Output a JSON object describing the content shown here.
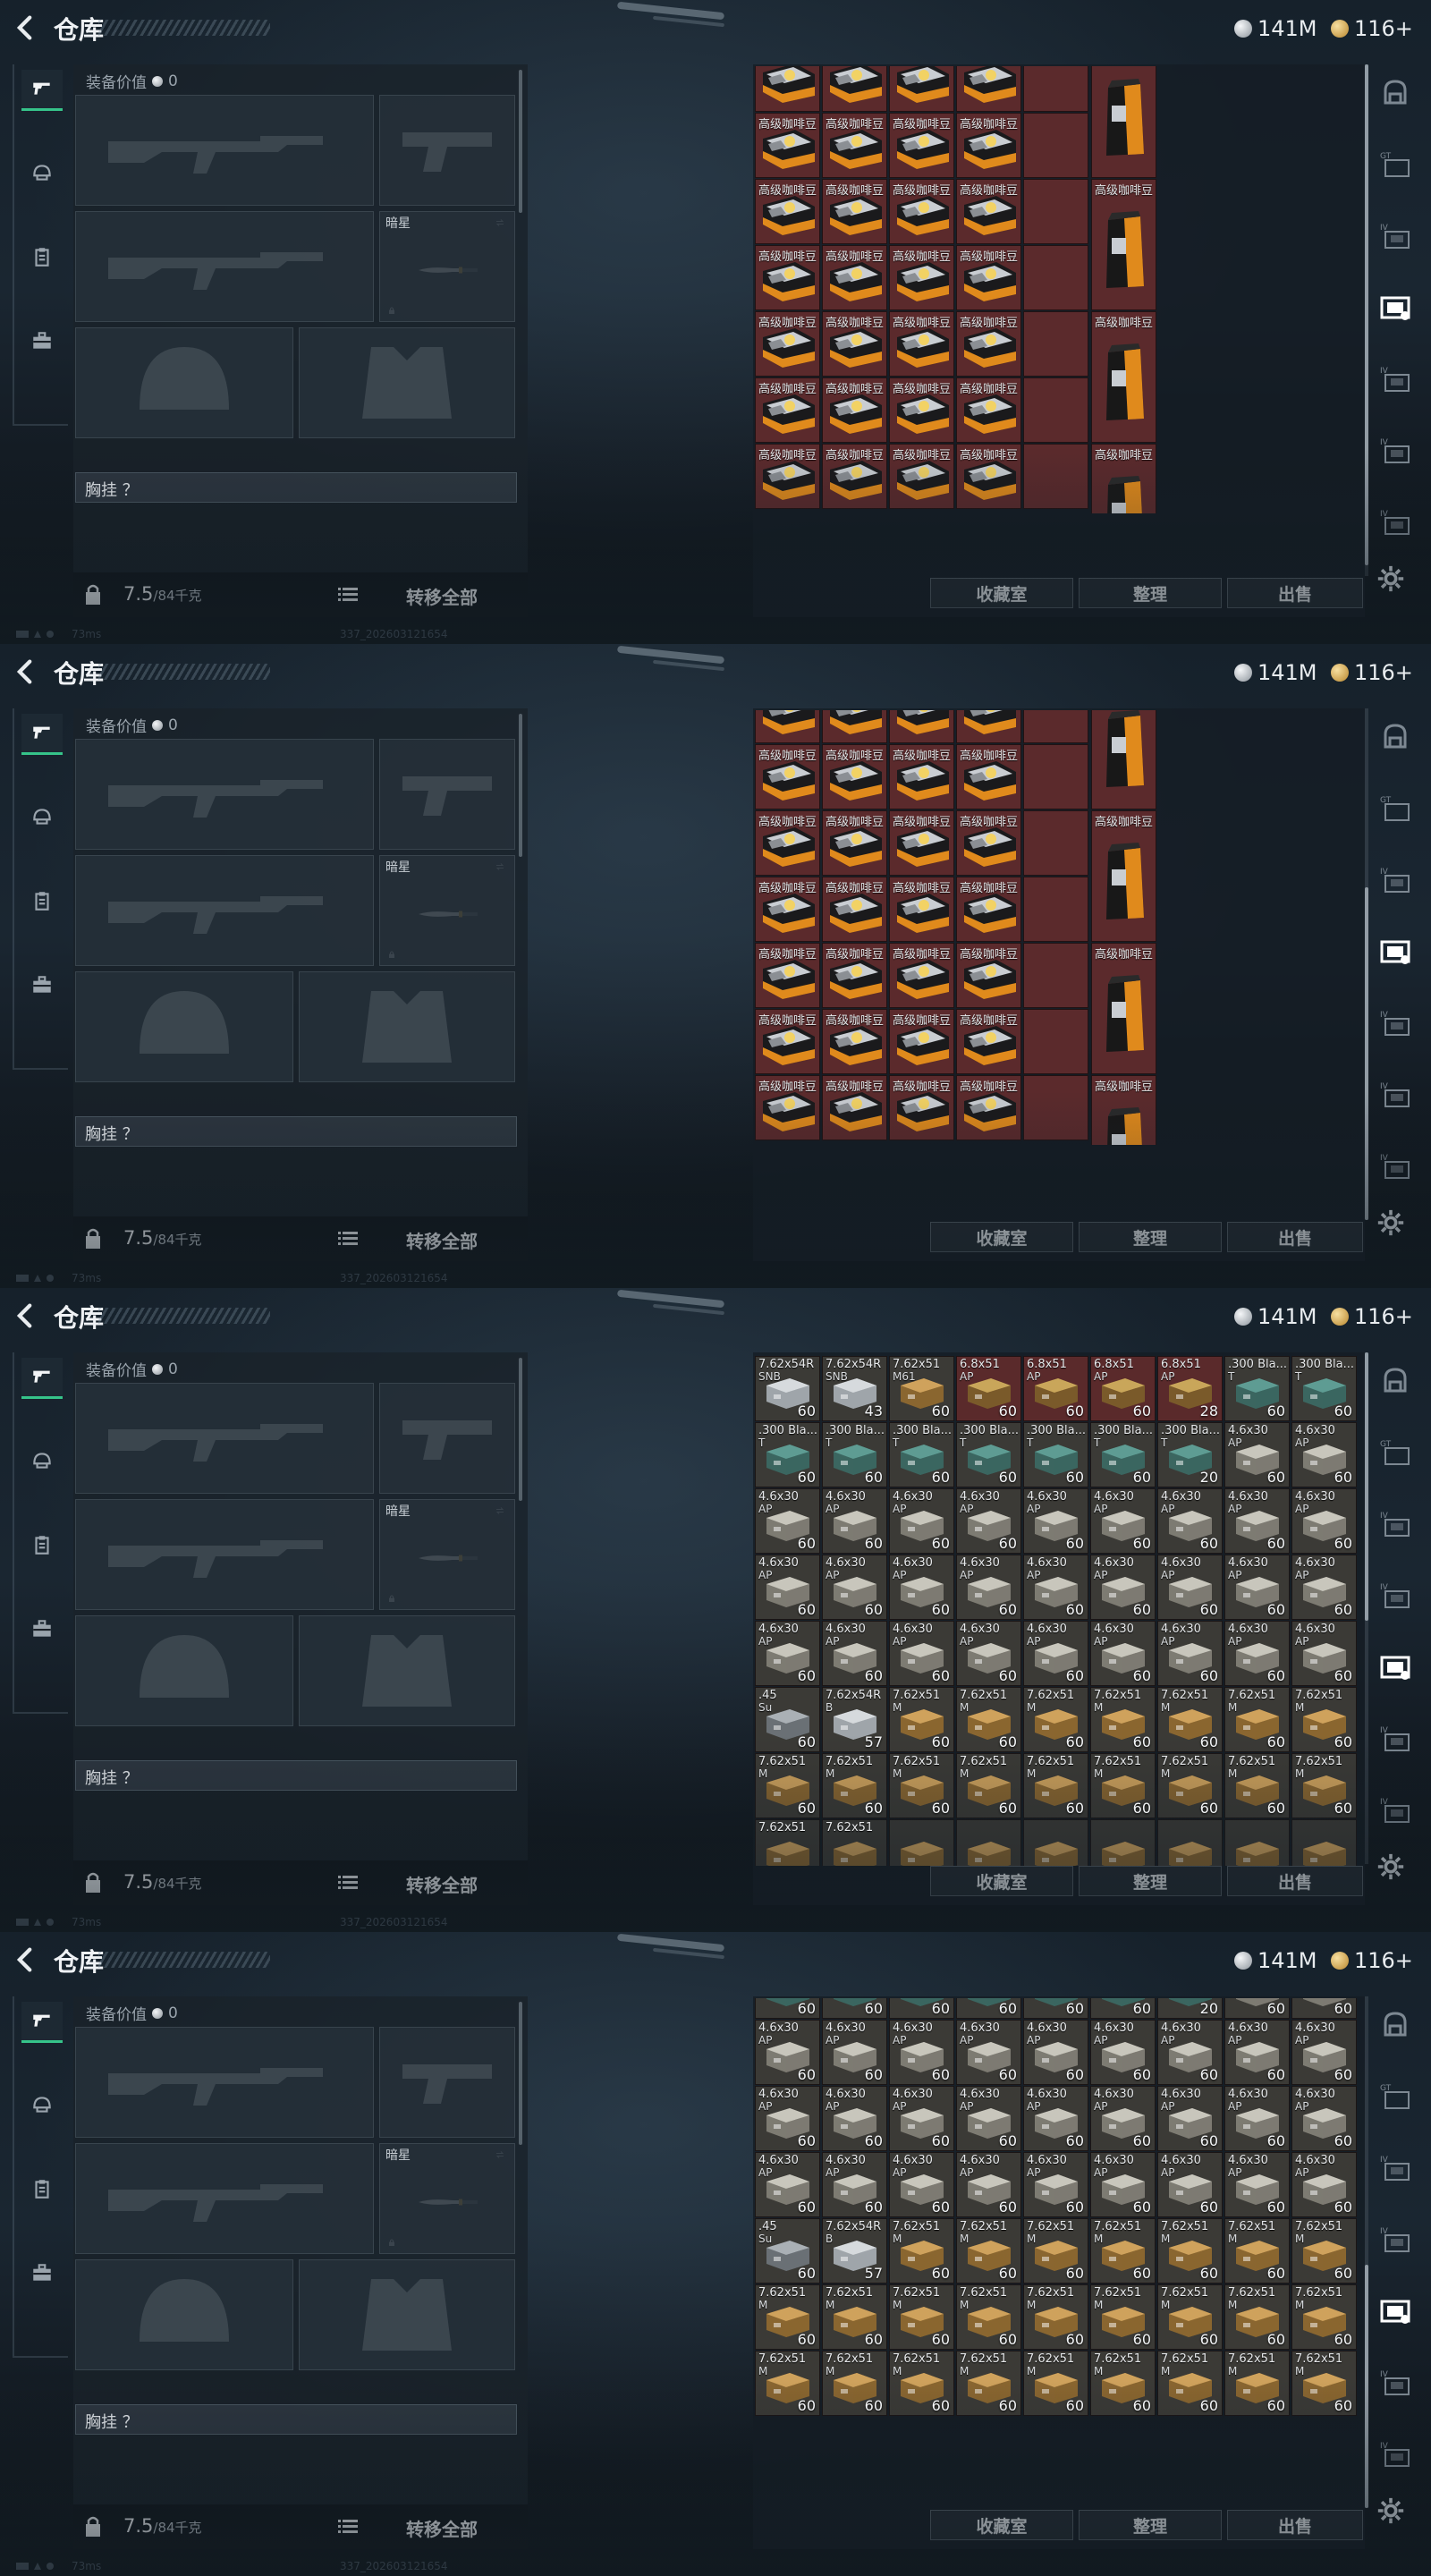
{
  "topbar": {
    "title": "仓库",
    "silver_amount": "141M",
    "gold_amount": "116+",
    "back_icon": "chevron-left-icon"
  },
  "equipment": {
    "value_label": "装备价值",
    "value_amount": "0",
    "knife_label": "暗星",
    "vest_label": "胸挂",
    "vest_hint": "？",
    "weight_current": "7.5",
    "weight_max": "/84千克",
    "transfer_all_label": "转移全部"
  },
  "left_tabs": [
    "pistol-icon",
    "helmet-icon",
    "clipboard-icon",
    "briefcase-icon"
  ],
  "right_tabs": [
    "backpack-icon",
    "case-icon",
    "case-iv-icon",
    "case-selected-icon",
    "case-iv-icon",
    "case-iv-icon",
    "case-iv-icon"
  ],
  "actions": {
    "collection_label": "收藏室",
    "sort_label": "整理",
    "sell_label": "出售"
  },
  "status": {
    "ping": "73ms",
    "build": "337_202603121654"
  },
  "coffee_item_name": "高级咖啡豆",
  "ammo_rows_frame3": [
    [
      {
        "nm": "7.62x54R",
        "sub": "SNB",
        "q": "60",
        "k": "box-white"
      },
      {
        "nm": "7.62x54R",
        "sub": "SNB",
        "q": "43",
        "k": "box-white"
      },
      {
        "nm": "7.62x51",
        "sub": "M61",
        "q": "60",
        "k": "box-tan"
      },
      {
        "nm": "6.8x51",
        "sub": "AP",
        "q": "60",
        "k": "ammo-red"
      },
      {
        "nm": "6.8x51",
        "sub": "AP",
        "q": "60",
        "k": "ammo-red"
      },
      {
        "nm": "6.8x51",
        "sub": "AP",
        "q": "60",
        "k": "ammo-red"
      },
      {
        "nm": "6.8x51",
        "sub": "AP",
        "q": "28",
        "k": "ammo-red"
      },
      {
        "nm": ".300 Bla...",
        "sub": "T",
        "q": "60",
        "k": "box-teal"
      },
      {
        "nm": ".300 Bla...",
        "sub": "T",
        "q": "60",
        "k": "box-teal"
      }
    ],
    [
      {
        "nm": ".300 Bla...",
        "sub": "T",
        "q": "60",
        "k": "box-teal"
      },
      {
        "nm": ".300 Bla...",
        "sub": "T",
        "q": "60",
        "k": "box-teal"
      },
      {
        "nm": ".300 Bla...",
        "sub": "T",
        "q": "60",
        "k": "box-teal"
      },
      {
        "nm": ".300 Bla...",
        "sub": "T",
        "q": "60",
        "k": "box-teal"
      },
      {
        "nm": ".300 Bla...",
        "sub": "T",
        "q": "60",
        "k": "box-teal"
      },
      {
        "nm": ".300 Bla...",
        "sub": "T",
        "q": "60",
        "k": "box-teal"
      },
      {
        "nm": ".300 Bla...",
        "sub": "T",
        "q": "20",
        "k": "box-teal"
      },
      {
        "nm": "4.6x30",
        "sub": "AP",
        "q": "60",
        "k": "box-grey"
      },
      {
        "nm": "4.6x30",
        "sub": "AP",
        "q": "60",
        "k": "box-grey"
      }
    ],
    [
      {
        "nm": "4.6x30",
        "sub": "AP",
        "q": "60",
        "k": "box-grey"
      },
      {
        "nm": "4.6x30",
        "sub": "AP",
        "q": "60",
        "k": "box-grey"
      },
      {
        "nm": "4.6x30",
        "sub": "AP",
        "q": "60",
        "k": "box-grey"
      },
      {
        "nm": "4.6x30",
        "sub": "AP",
        "q": "60",
        "k": "box-grey"
      },
      {
        "nm": "4.6x30",
        "sub": "AP",
        "q": "60",
        "k": "box-grey"
      },
      {
        "nm": "4.6x30",
        "sub": "AP",
        "q": "60",
        "k": "box-grey"
      },
      {
        "nm": "4.6x30",
        "sub": "AP",
        "q": "60",
        "k": "box-grey"
      },
      {
        "nm": "4.6x30",
        "sub": "AP",
        "q": "60",
        "k": "box-grey"
      },
      {
        "nm": "4.6x30",
        "sub": "AP",
        "q": "60",
        "k": "box-grey"
      }
    ],
    [
      {
        "nm": "4.6x30",
        "sub": "AP",
        "q": "60",
        "k": "box-grey"
      },
      {
        "nm": "4.6x30",
        "sub": "AP",
        "q": "60",
        "k": "box-grey"
      },
      {
        "nm": "4.6x30",
        "sub": "AP",
        "q": "60",
        "k": "box-grey"
      },
      {
        "nm": "4.6x30",
        "sub": "AP",
        "q": "60",
        "k": "box-grey"
      },
      {
        "nm": "4.6x30",
        "sub": "AP",
        "q": "60",
        "k": "box-grey"
      },
      {
        "nm": "4.6x30",
        "sub": "AP",
        "q": "60",
        "k": "box-grey"
      },
      {
        "nm": "4.6x30",
        "sub": "AP",
        "q": "60",
        "k": "box-grey"
      },
      {
        "nm": "4.6x30",
        "sub": "AP",
        "q": "60",
        "k": "box-grey"
      },
      {
        "nm": "4.6x30",
        "sub": "AP",
        "q": "60",
        "k": "box-grey"
      }
    ],
    [
      {
        "nm": "4.6x30",
        "sub": "AP",
        "q": "60",
        "k": "box-grey"
      },
      {
        "nm": "4.6x30",
        "sub": "AP",
        "q": "60",
        "k": "box-grey"
      },
      {
        "nm": "4.6x30",
        "sub": "AP",
        "q": "60",
        "k": "box-grey"
      },
      {
        "nm": "4.6x30",
        "sub": "AP",
        "q": "60",
        "k": "box-grey"
      },
      {
        "nm": "4.6x30",
        "sub": "AP",
        "q": "60",
        "k": "box-grey"
      },
      {
        "nm": "4.6x30",
        "sub": "AP",
        "q": "60",
        "k": "box-grey"
      },
      {
        "nm": "4.6x30",
        "sub": "AP",
        "q": "60",
        "k": "box-grey"
      },
      {
        "nm": "4.6x30",
        "sub": "AP",
        "q": "60",
        "k": "box-grey"
      },
      {
        "nm": "4.6x30",
        "sub": "AP",
        "q": "60",
        "k": "box-grey"
      }
    ],
    [
      {
        "nm": ".45",
        "sub": "Su",
        "q": "60",
        "k": "box-steel"
      },
      {
        "nm": "7.62x54R",
        "sub": "B",
        "q": "57",
        "k": "box-white"
      },
      {
        "nm": "7.62x51",
        "sub": "M",
        "q": "60",
        "k": "box-tan"
      },
      {
        "nm": "7.62x51",
        "sub": "M",
        "q": "60",
        "k": "box-tan"
      },
      {
        "nm": "7.62x51",
        "sub": "M",
        "q": "60",
        "k": "box-tan"
      },
      {
        "nm": "7.62x51",
        "sub": "M",
        "q": "60",
        "k": "box-tan"
      },
      {
        "nm": "7.62x51",
        "sub": "M",
        "q": "60",
        "k": "box-tan"
      },
      {
        "nm": "7.62x51",
        "sub": "M",
        "q": "60",
        "k": "box-tan"
      },
      {
        "nm": "7.62x51",
        "sub": "M",
        "q": "60",
        "k": "box-tan"
      }
    ],
    [
      {
        "nm": "7.62x51",
        "sub": "M",
        "q": "60",
        "k": "box-tan"
      },
      {
        "nm": "7.62x51",
        "sub": "M",
        "q": "60",
        "k": "box-tan"
      },
      {
        "nm": "7.62x51",
        "sub": "M",
        "q": "60",
        "k": "box-tan"
      },
      {
        "nm": "7.62x51",
        "sub": "M",
        "q": "60",
        "k": "box-tan"
      },
      {
        "nm": "7.62x51",
        "sub": "M",
        "q": "60",
        "k": "box-tan"
      },
      {
        "nm": "7.62x51",
        "sub": "M",
        "q": "60",
        "k": "box-tan"
      },
      {
        "nm": "7.62x51",
        "sub": "M",
        "q": "60",
        "k": "box-tan"
      },
      {
        "nm": "7.62x51",
        "sub": "M",
        "q": "60",
        "k": "box-tan"
      },
      {
        "nm": "7.62x51",
        "sub": "M",
        "q": "60",
        "k": "box-tan"
      }
    ],
    [
      {
        "nm": "7.62x51",
        "sub": "",
        "q": "",
        "k": "box-tan"
      },
      {
        "nm": "7.62x51",
        "sub": "",
        "q": "",
        "k": "box-tan"
      },
      {
        "nm": "",
        "sub": "",
        "q": "",
        "k": "box-tan"
      },
      {
        "nm": "",
        "sub": "",
        "q": "",
        "k": "box-tan"
      },
      {
        "nm": "",
        "sub": "",
        "q": "",
        "k": "box-tan"
      },
      {
        "nm": "",
        "sub": "",
        "q": "",
        "k": "box-tan"
      },
      {
        "nm": "",
        "sub": "",
        "q": "",
        "k": "box-tan"
      },
      {
        "nm": "",
        "sub": "",
        "q": "",
        "k": "box-tan"
      },
      {
        "nm": "",
        "sub": "",
        "q": "",
        "k": "box-tan"
      }
    ]
  ],
  "ammo_rows_frame4": [
    [
      {
        "nm": "",
        "sub": "",
        "q": "60",
        "k": "box-teal"
      },
      {
        "nm": "",
        "sub": "",
        "q": "60",
        "k": "box-teal"
      },
      {
        "nm": "",
        "sub": "",
        "q": "60",
        "k": "box-teal"
      },
      {
        "nm": "",
        "sub": "",
        "q": "60",
        "k": "box-teal"
      },
      {
        "nm": "",
        "sub": "",
        "q": "60",
        "k": "box-teal"
      },
      {
        "nm": "",
        "sub": "",
        "q": "60",
        "k": "box-teal"
      },
      {
        "nm": "",
        "sub": "",
        "q": "20",
        "k": "box-teal"
      },
      {
        "nm": "",
        "sub": "",
        "q": "60",
        "k": "box-grey"
      },
      {
        "nm": "",
        "sub": "",
        "q": "60",
        "k": "box-grey"
      }
    ],
    [
      {
        "nm": "4.6x30",
        "sub": "AP",
        "q": "60",
        "k": "box-grey"
      },
      {
        "nm": "4.6x30",
        "sub": "AP",
        "q": "60",
        "k": "box-grey"
      },
      {
        "nm": "4.6x30",
        "sub": "AP",
        "q": "60",
        "k": "box-grey"
      },
      {
        "nm": "4.6x30",
        "sub": "AP",
        "q": "60",
        "k": "box-grey"
      },
      {
        "nm": "4.6x30",
        "sub": "AP",
        "q": "60",
        "k": "box-grey"
      },
      {
        "nm": "4.6x30",
        "sub": "AP",
        "q": "60",
        "k": "box-grey"
      },
      {
        "nm": "4.6x30",
        "sub": "AP",
        "q": "60",
        "k": "box-grey"
      },
      {
        "nm": "4.6x30",
        "sub": "AP",
        "q": "60",
        "k": "box-grey"
      },
      {
        "nm": "4.6x30",
        "sub": "AP",
        "q": "60",
        "k": "box-grey"
      }
    ],
    [
      {
        "nm": "4.6x30",
        "sub": "AP",
        "q": "60",
        "k": "box-grey"
      },
      {
        "nm": "4.6x30",
        "sub": "AP",
        "q": "60",
        "k": "box-grey"
      },
      {
        "nm": "4.6x30",
        "sub": "AP",
        "q": "60",
        "k": "box-grey"
      },
      {
        "nm": "4.6x30",
        "sub": "AP",
        "q": "60",
        "k": "box-grey"
      },
      {
        "nm": "4.6x30",
        "sub": "AP",
        "q": "60",
        "k": "box-grey"
      },
      {
        "nm": "4.6x30",
        "sub": "AP",
        "q": "60",
        "k": "box-grey"
      },
      {
        "nm": "4.6x30",
        "sub": "AP",
        "q": "60",
        "k": "box-grey"
      },
      {
        "nm": "4.6x30",
        "sub": "AP",
        "q": "60",
        "k": "box-grey"
      },
      {
        "nm": "4.6x30",
        "sub": "AP",
        "q": "60",
        "k": "box-grey"
      }
    ],
    [
      {
        "nm": "4.6x30",
        "sub": "AP",
        "q": "60",
        "k": "box-grey"
      },
      {
        "nm": "4.6x30",
        "sub": "AP",
        "q": "60",
        "k": "box-grey"
      },
      {
        "nm": "4.6x30",
        "sub": "AP",
        "q": "60",
        "k": "box-grey"
      },
      {
        "nm": "4.6x30",
        "sub": "AP",
        "q": "60",
        "k": "box-grey"
      },
      {
        "nm": "4.6x30",
        "sub": "AP",
        "q": "60",
        "k": "box-grey"
      },
      {
        "nm": "4.6x30",
        "sub": "AP",
        "q": "60",
        "k": "box-grey"
      },
      {
        "nm": "4.6x30",
        "sub": "AP",
        "q": "60",
        "k": "box-grey"
      },
      {
        "nm": "4.6x30",
        "sub": "AP",
        "q": "60",
        "k": "box-grey"
      },
      {
        "nm": "4.6x30",
        "sub": "AP",
        "q": "60",
        "k": "box-grey"
      }
    ],
    [
      {
        "nm": ".45",
        "sub": "Su",
        "q": "60",
        "k": "box-steel"
      },
      {
        "nm": "7.62x54R",
        "sub": "B",
        "q": "57",
        "k": "box-white"
      },
      {
        "nm": "7.62x51",
        "sub": "M",
        "q": "60",
        "k": "box-tan"
      },
      {
        "nm": "7.62x51",
        "sub": "M",
        "q": "60",
        "k": "box-tan"
      },
      {
        "nm": "7.62x51",
        "sub": "M",
        "q": "60",
        "k": "box-tan"
      },
      {
        "nm": "7.62x51",
        "sub": "M",
        "q": "60",
        "k": "box-tan"
      },
      {
        "nm": "7.62x51",
        "sub": "M",
        "q": "60",
        "k": "box-tan"
      },
      {
        "nm": "7.62x51",
        "sub": "M",
        "q": "60",
        "k": "box-tan"
      },
      {
        "nm": "7.62x51",
        "sub": "M",
        "q": "60",
        "k": "box-tan"
      }
    ],
    [
      {
        "nm": "7.62x51",
        "sub": "M",
        "q": "60",
        "k": "box-tan"
      },
      {
        "nm": "7.62x51",
        "sub": "M",
        "q": "60",
        "k": "box-tan"
      },
      {
        "nm": "7.62x51",
        "sub": "M",
        "q": "60",
        "k": "box-tan"
      },
      {
        "nm": "7.62x51",
        "sub": "M",
        "q": "60",
        "k": "box-tan"
      },
      {
        "nm": "7.62x51",
        "sub": "M",
        "q": "60",
        "k": "box-tan"
      },
      {
        "nm": "7.62x51",
        "sub": "M",
        "q": "60",
        "k": "box-tan"
      },
      {
        "nm": "7.62x51",
        "sub": "M",
        "q": "60",
        "k": "box-tan"
      },
      {
        "nm": "7.62x51",
        "sub": "M",
        "q": "60",
        "k": "box-tan"
      },
      {
        "nm": "7.62x51",
        "sub": "M",
        "q": "60",
        "k": "box-tan"
      }
    ],
    [
      {
        "nm": "7.62x51",
        "sub": "M",
        "q": "60",
        "k": "box-tan"
      },
      {
        "nm": "7.62x51",
        "sub": "M",
        "q": "60",
        "k": "box-tan"
      },
      {
        "nm": "7.62x51",
        "sub": "M",
        "q": "60",
        "k": "box-tan"
      },
      {
        "nm": "7.62x51",
        "sub": "M",
        "q": "60",
        "k": "box-tan"
      },
      {
        "nm": "7.62x51",
        "sub": "M",
        "q": "60",
        "k": "box-tan"
      },
      {
        "nm": "7.62x51",
        "sub": "M",
        "q": "60",
        "k": "box-tan"
      },
      {
        "nm": "7.62x51",
        "sub": "M",
        "q": "60",
        "k": "box-tan"
      },
      {
        "nm": "7.62x51",
        "sub": "M",
        "q": "60",
        "k": "box-tan"
      },
      {
        "nm": "7.62x51",
        "sub": "M",
        "q": "60",
        "k": "box-tan"
      }
    ]
  ]
}
